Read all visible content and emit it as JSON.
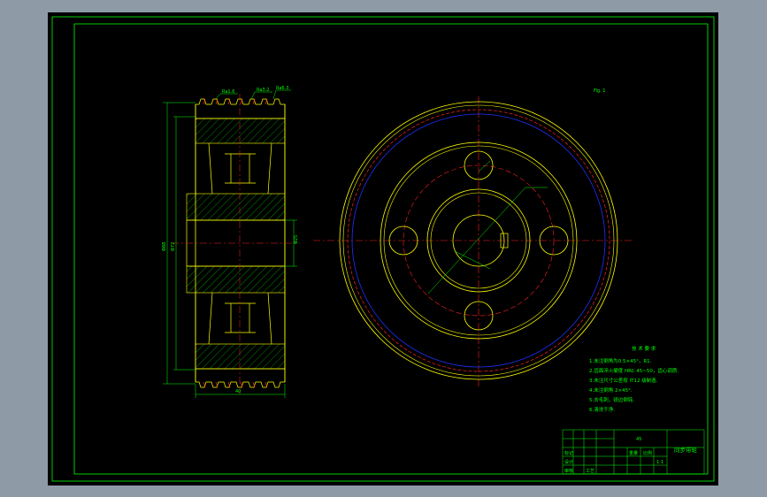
{
  "drawing": {
    "sheet_label": "Fig. 1",
    "notes": {
      "heading": "技 术 要 求",
      "lines": [
        "1.未注倒角为0.5×45°，R1.",
        "2.齿面淬火硬度 HRC 45~50，齿心调质.",
        "3.未注尺寸公差按 IT12 级制造.",
        "4.未注倒角 2×45°.",
        "5.去毛刺，锐边倒钝.",
        "6.清洗干净."
      ]
    },
    "title_block": {
      "part_name": "同步带轮",
      "material": "45",
      "scale": "1:1",
      "row_labels": [
        "标记",
        "设计",
        "审核",
        "工艺"
      ],
      "weight_label": "重量",
      "scale_label": "比例"
    },
    "section_labels": {
      "dim_outer": "Φ88",
      "dim_inner": "Φ72",
      "dim_bore": "Φ25",
      "dim_width": "40",
      "roughness_1": "Ra1.6",
      "roughness_2": "Ra3.2",
      "roughness_3": "Ra6.3"
    },
    "colors": {
      "background": "#000000",
      "frame": "#00ff00",
      "outline": "#ffff00",
      "center_line": "#ff2020",
      "pitch_circle": "#2030ff",
      "hatch": "#00d000",
      "dim": "#00ff00"
    }
  }
}
